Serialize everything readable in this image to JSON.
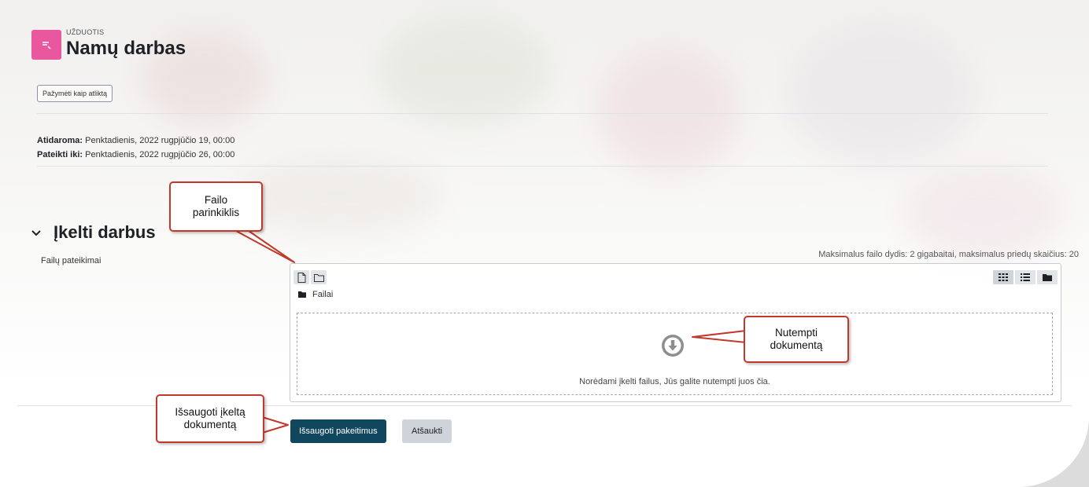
{
  "header": {
    "overline": "UŽDUOTIS",
    "title": "Namų darbas",
    "icon": "assignment-icon",
    "icon_color": "#e9579f"
  },
  "completion": {
    "button_label": "Pažymėti kaip atliktą"
  },
  "dates": {
    "opens_label": "Atidaroma:",
    "opens_value": "Penktadienis, 2022 rugpjūčio 19, 00:00",
    "due_label": "Pateikti iki:",
    "due_value": "Penktadienis, 2022 rugpjūčio 26, 00:00"
  },
  "section": {
    "title": "Įkelti darbus",
    "icon": "chevron-down-icon"
  },
  "file_field": {
    "label": "Failų pateikimai",
    "limits": "Maksimalus failo dydis: 2 gigabaitai, maksimalus priedų skaičius: 20",
    "toolbar": [
      {
        "name": "add-file",
        "icon": "file-icon"
      },
      {
        "name": "create-folder",
        "icon": "folder-icon"
      }
    ],
    "views": [
      {
        "name": "icons",
        "icon": "grid-icon",
        "active": true
      },
      {
        "name": "list",
        "icon": "list-icon",
        "active": false
      },
      {
        "name": "tree",
        "icon": "folder-solid-icon",
        "active": false
      }
    ],
    "path_label": "Failai",
    "dropzone_text": "Norėdami įkelti failus, Jūs galite nutempti juos čia.",
    "dropzone_icon": "arrow-circle-down-icon"
  },
  "actions": {
    "save_label": "Išsaugoti pakeitimus",
    "cancel_label": "Atšaukti",
    "primary_color": "#10465e"
  },
  "callouts": {
    "file_picker": "Failo parinkiklis",
    "drag_document": "Nutempti dokumentą",
    "save_document": "Išsaugoti įkeltą dokumentą",
    "border_color": "#c0392b"
  }
}
